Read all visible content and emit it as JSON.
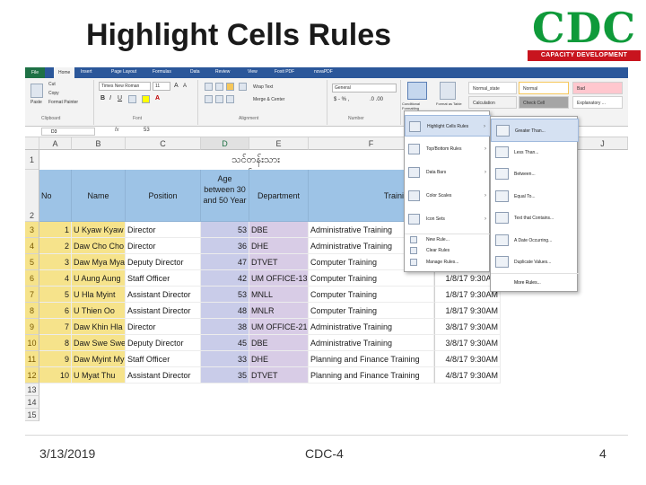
{
  "slide": {
    "title": "Highlight Cells Rules",
    "footer_date": "3/13/2019",
    "footer_center": "CDC-4",
    "footer_page": "4"
  },
  "logo": {
    "mark": "CDC",
    "tagline": "CAPACITY DEVELOPMENT CENTER"
  },
  "ribbon": {
    "tabs": [
      "File",
      "Home",
      "Insert",
      "Page Layout",
      "Formulas",
      "Data",
      "Review",
      "View",
      "Foxit PDF",
      "novaPDF"
    ],
    "paste_label": "Paste",
    "cut_label": "Cut",
    "copy_label": "Copy",
    "format_painter_label": "Format Painter",
    "font_name": "Times New Roman",
    "font_size": "11",
    "wrap_text_label": "Wrap Text",
    "merge_label": "Merge & Center",
    "number_format": "General",
    "cf_label": "Conditional Formatting",
    "format_table_label": "Format as Table",
    "styles": [
      {
        "label": "Normal_state",
        "bg": "#ffffff"
      },
      {
        "label": "Normal",
        "bg": "#ffffff"
      },
      {
        "label": "Bad",
        "bg": "#ffc7ce"
      },
      {
        "label": "Calculation",
        "bg": "#f2f2f2"
      },
      {
        "label": "Check Cell",
        "bg": "#a5a5a5"
      },
      {
        "label": "Explanatory ...",
        "bg": "#ffffff"
      }
    ],
    "groups": [
      "Clipboard",
      "Font",
      "Alignment",
      "Number"
    ]
  },
  "formula_bar": {
    "name_box": "D3",
    "fx": "fx",
    "value": "53"
  },
  "sheet": {
    "columns": [
      "A",
      "B",
      "C",
      "D",
      "E",
      "F",
      "J"
    ],
    "title_text": "သင်တန်းသားစာရင်း",
    "headers": {
      "no": "No",
      "name": "Name",
      "position": "Position",
      "age": "Age between 30 and 50 Year",
      "department": "Department",
      "training_title": "Training Title"
    },
    "rows": [
      {
        "row": "3",
        "no": "1",
        "name": "U Kyaw Kyaw",
        "position": "Director",
        "age": "53",
        "dept": "DBE",
        "training": "Administrative Training",
        "date": ""
      },
      {
        "row": "4",
        "no": "2",
        "name": "Daw Cho Cho",
        "position": "Director",
        "age": "36",
        "dept": "DHE",
        "training": "Administrative Training",
        "date": ""
      },
      {
        "row": "5",
        "no": "3",
        "name": "Daw Mya Mya",
        "position": "Deputy Director",
        "age": "47",
        "dept": "DTVET",
        "training": "Computer Training",
        "date": "1/8/17 9:30AM"
      },
      {
        "row": "6",
        "no": "4",
        "name": "U Aung Aung",
        "position": "Staff Officer",
        "age": "42",
        "dept": "UM OFFICE-13",
        "training": "Computer Training",
        "date": "1/8/17 9:30AM"
      },
      {
        "row": "7",
        "no": "5",
        "name": "U Hla Myint",
        "position": "Assistant Director",
        "age": "53",
        "dept": "MNLL",
        "training": "Computer Training",
        "date": "1/8/17 9:30AM"
      },
      {
        "row": "8",
        "no": "6",
        "name": "U Thien Oo",
        "position": "Assistant Director",
        "age": "48",
        "dept": "MNLR",
        "training": "Computer Training",
        "date": "1/8/17 9:30AM"
      },
      {
        "row": "9",
        "no": "7",
        "name": "Daw Khin Hla",
        "position": "Director",
        "age": "38",
        "dept": "UM OFFICE-21",
        "training": "Administrative Training",
        "date": "3/8/17 9:30AM"
      },
      {
        "row": "10",
        "no": "8",
        "name": "Daw Swe Swe",
        "position": "Deputy Director",
        "age": "45",
        "dept": "DBE",
        "training": "Administrative Training",
        "date": "3/8/17 9:30AM"
      },
      {
        "row": "11",
        "no": "9",
        "name": "Daw Myint Myint",
        "position": "Staff Officer",
        "age": "33",
        "dept": "DHE",
        "training": "Planning and Finance Training",
        "date": "4/8/17 9:30AM"
      },
      {
        "row": "12",
        "no": "10",
        "name": "U Myat Thu",
        "position": "Assistant Director",
        "age": "35",
        "dept": "DTVET",
        "training": "Planning and Finance Training",
        "date": "4/8/17 9:30AM"
      }
    ],
    "extra_rows": [
      "13",
      "14",
      "15"
    ]
  },
  "cf_menu": {
    "items": [
      {
        "label": "Highlight Cells Rules",
        "hover": true
      },
      {
        "label": "Top/Bottom Rules",
        "hover": false
      },
      {
        "label": "Data Bars",
        "hover": false
      },
      {
        "label": "Color Scales",
        "hover": false
      },
      {
        "label": "Icon Sets",
        "hover": false
      }
    ],
    "small_items": [
      "New Rule...",
      "Clear Rules",
      "Manage Rules..."
    ]
  },
  "sub_menu": {
    "items": [
      {
        "label": "Greater Than...",
        "hover": true
      },
      {
        "label": "Less Than...",
        "hover": false
      },
      {
        "label": "Between...",
        "hover": false
      },
      {
        "label": "Equal To...",
        "hover": false
      },
      {
        "label": "Text that Contains...",
        "hover": false
      },
      {
        "label": "A Date Occurring...",
        "hover": false
      },
      {
        "label": "Duplicate Values...",
        "hover": false
      }
    ],
    "more": "More Rules..."
  },
  "colors": {
    "header_fill": "#9dc3e6",
    "age_highlight": "#c9cce9",
    "dept_highlight": "#d8cce6",
    "row_header_selected": "#f6e38b",
    "logo_green": "#0f9a3a",
    "logo_red": "#c8141e"
  }
}
